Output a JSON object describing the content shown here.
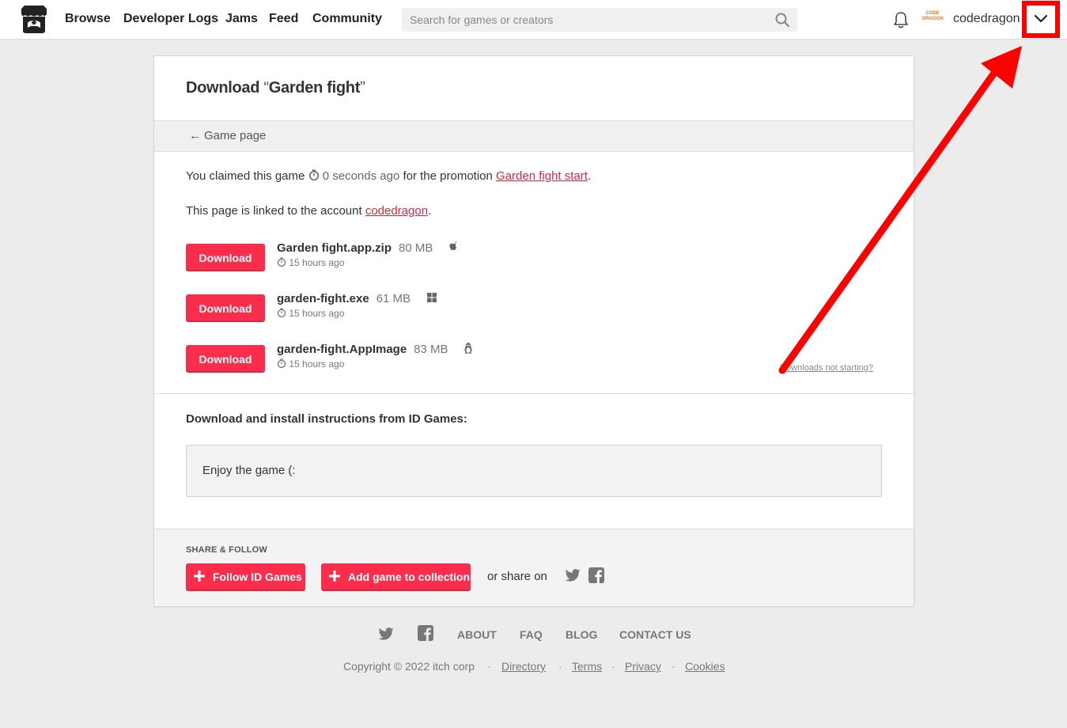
{
  "header": {
    "nav": [
      {
        "label": "Browse"
      },
      {
        "label": "Developer Logs"
      },
      {
        "label": "Jams"
      },
      {
        "label": "Feed"
      },
      {
        "label": "Community"
      }
    ],
    "search_placeholder": "Search for games or creators",
    "avatar_text": "CODE DRAGON",
    "username": "codedragon"
  },
  "card": {
    "title_prefix": "Download ",
    "open_quote": "“",
    "game_name": "Garden fight",
    "close_quote": "”",
    "back_label": "Game page",
    "claim_prefix": "You claimed this game",
    "claim_time": "0 seconds ago",
    "claim_mid": "for the promotion",
    "promotion": "Garden fight start",
    "claim_end": ".",
    "linked_prefix": "This page is linked to the account",
    "account": "codedragon",
    "linked_end": ".",
    "downloads": [
      {
        "button": "Download",
        "filename": "Garden fight.app.zip",
        "size": "80 MB",
        "platform": "apple-icon",
        "uploaded": "15 hours ago"
      },
      {
        "button": "Download",
        "filename": "garden-fight.exe",
        "size": "61 MB",
        "platform": "windows-icon",
        "uploaded": "15 hours ago"
      },
      {
        "button": "Download",
        "filename": "garden-fight.AppImage",
        "size": "83 MB",
        "platform": "linux-icon",
        "uploaded": "15 hours ago"
      }
    ],
    "not_starting": "Downloads not starting?",
    "instructions_title": "Download and install instructions from ID Games:",
    "instructions_text": "Enjoy the game (:",
    "share_label": "SHARE & FOLLOW",
    "follow_button": "Follow ID Games",
    "collection_button": "Add game to collection",
    "share_on": "or share on"
  },
  "footer": {
    "links": [
      "ABOUT",
      "FAQ",
      "BLOG",
      "CONTACT US"
    ],
    "copyright": "Copyright © 2022 itch corp",
    "sub_links": [
      "Directory",
      "Terms",
      "Privacy",
      "Cookies"
    ]
  },
  "colors": {
    "accent": "#fa2d4d",
    "link": "#d8283b",
    "highlight": "#ff0000"
  }
}
